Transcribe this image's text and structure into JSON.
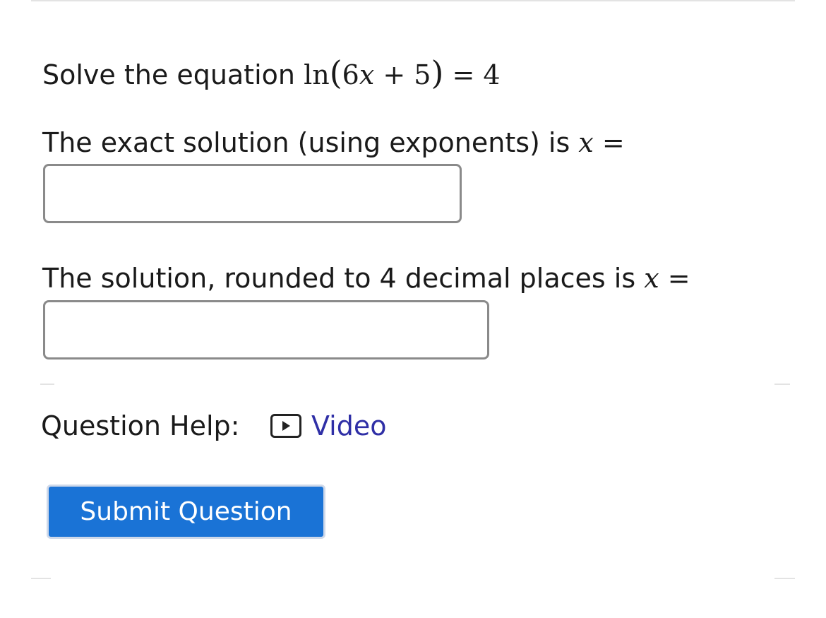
{
  "question": {
    "prompt_prefix": "Solve the equation ",
    "equation": {
      "fn": "ln",
      "open": "(",
      "coef": "6",
      "var": "x",
      "plus": " + ",
      "const": "5",
      "close": ")",
      "eq": " = ",
      "rhs": "4"
    }
  },
  "part_exact": {
    "label_prefix": "The exact solution (using exponents) is ",
    "var": "x",
    "eq": " =",
    "input_value": ""
  },
  "part_rounded": {
    "label_prefix": "The solution, rounded to 4 decimal places is ",
    "var": "x",
    "eq": " =",
    "input_value": ""
  },
  "help": {
    "label": "Question Help:",
    "video_icon": "play-box-icon",
    "video_label": "Video"
  },
  "submit": {
    "label": "Submit Question"
  },
  "colors": {
    "submit_bg": "#1a73d6",
    "link": "#2f2fa6",
    "input_border": "#8a8a8a"
  }
}
